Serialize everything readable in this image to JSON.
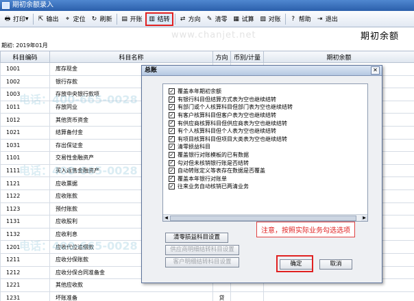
{
  "window": {
    "title": "期初余额录入"
  },
  "toolbar": {
    "buttons": [
      {
        "name": "print",
        "label": "打印",
        "icon": "print-icon",
        "glyph": "🖶",
        "dropdown": true
      },
      {
        "name": "export",
        "label": "输出",
        "icon": "export-icon",
        "glyph": "⇱"
      },
      {
        "name": "locate",
        "label": "定位",
        "icon": "locate-icon",
        "glyph": "⌖"
      },
      {
        "name": "refresh",
        "label": "刷新",
        "icon": "refresh-icon",
        "glyph": "↻"
      },
      {
        "name": "open-account",
        "label": "开账",
        "icon": "open-book-icon",
        "glyph": "▤"
      },
      {
        "name": "carry-over",
        "label": "结转",
        "icon": "carry-over-icon",
        "glyph": "▥",
        "active": true
      },
      {
        "name": "direction",
        "label": "方向",
        "icon": "direction-icon",
        "glyph": "⇄"
      },
      {
        "name": "clear-zero",
        "label": "清零",
        "icon": "broom-icon",
        "glyph": "✎"
      },
      {
        "name": "trial-balance",
        "label": "试算",
        "icon": "calc-icon",
        "glyph": "▦"
      },
      {
        "name": "reconcile",
        "label": "对账",
        "icon": "reconcile-icon",
        "glyph": "▧"
      },
      {
        "name": "help",
        "label": "帮助",
        "icon": "help-icon",
        "glyph": "?"
      },
      {
        "name": "exit",
        "label": "退出",
        "icon": "exit-icon",
        "glyph": "⇥"
      }
    ]
  },
  "page": {
    "title": "期初余额",
    "period": "期初: 2019年01月"
  },
  "watermark": {
    "text": "电话：400-665-0028",
    "url": "www.chanjet.net"
  },
  "table": {
    "columns": [
      "科目编码",
      "科目名称",
      "方向",
      "币别/计量",
      "期初余额"
    ],
    "rows": [
      {
        "code": "1001",
        "name": "库存现金",
        "dir": ""
      },
      {
        "code": "1002",
        "name": "银行存款",
        "dir": ""
      },
      {
        "code": "1003",
        "name": "存放中央银行款项",
        "dir": ""
      },
      {
        "code": "1011",
        "name": "存放同业",
        "dir": ""
      },
      {
        "code": "1012",
        "name": "其他货币资金",
        "dir": ""
      },
      {
        "code": "1021",
        "name": "结算备付金",
        "dir": ""
      },
      {
        "code": "1031",
        "name": "存出保证金",
        "dir": ""
      },
      {
        "code": "1101",
        "name": "交易性金融资产",
        "dir": ""
      },
      {
        "code": "1111",
        "name": "买入返售金融资产",
        "dir": ""
      },
      {
        "code": "1121",
        "name": "应收票据",
        "dir": ""
      },
      {
        "code": "1122",
        "name": "应收账款",
        "dir": ""
      },
      {
        "code": "1123",
        "name": "预付账款",
        "dir": ""
      },
      {
        "code": "1131",
        "name": "应收股利",
        "dir": ""
      },
      {
        "code": "1132",
        "name": "应收利息",
        "dir": ""
      },
      {
        "code": "1201",
        "name": "应收代位追偿款",
        "dir": ""
      },
      {
        "code": "1211",
        "name": "应收分保账款",
        "dir": ""
      },
      {
        "code": "1212",
        "name": "应收分保合同准备金",
        "dir": ""
      },
      {
        "code": "1221",
        "name": "其他应收款",
        "dir": ""
      },
      {
        "code": "1231",
        "name": "坏账准备",
        "dir": "贷"
      }
    ]
  },
  "dialog": {
    "title": "总账",
    "close_glyph": "✕",
    "options": [
      {
        "label": "覆盖本年期初余额",
        "checked": true
      },
      {
        "label": "有银行科目但结算方式表为空也继续结转",
        "checked": true
      },
      {
        "label": "有部门或个人核算科目但部门表为空也继续结转",
        "checked": true
      },
      {
        "label": "有客户核算科目但客户表为空也继续结转",
        "checked": true
      },
      {
        "label": "有供应商核算科目但供应商表为空也继续结转",
        "checked": true
      },
      {
        "label": "有个人核算科目但个人表为空也继续结转",
        "checked": true
      },
      {
        "label": "有项目核算科目但项目大类表为空也继续结转",
        "checked": true
      },
      {
        "label": "清零损益科目",
        "checked": true
      },
      {
        "label": "覆盖银行对账模板的已有数据",
        "checked": true
      },
      {
        "label": "勾对但未核销银行账是否结转",
        "checked": true
      },
      {
        "label": "自动转账定义等表存在数据是否覆盖",
        "checked": true
      },
      {
        "label": "覆盖本年银行对账单",
        "checked": true
      },
      {
        "label": "往来业务自动核销已两清业务",
        "checked": true
      }
    ],
    "buttons": {
      "clear_pl": "清零损益科目设置",
      "vendor_detail": "供应商明细结转科目设置",
      "customer_detail": "客户明细结转科目设置",
      "ok": "确定",
      "cancel": "取消"
    },
    "note": "注意，按照实际业务勾选选项"
  },
  "colors": {
    "highlight": "#e02020",
    "titlebar": "#2b5fab"
  }
}
